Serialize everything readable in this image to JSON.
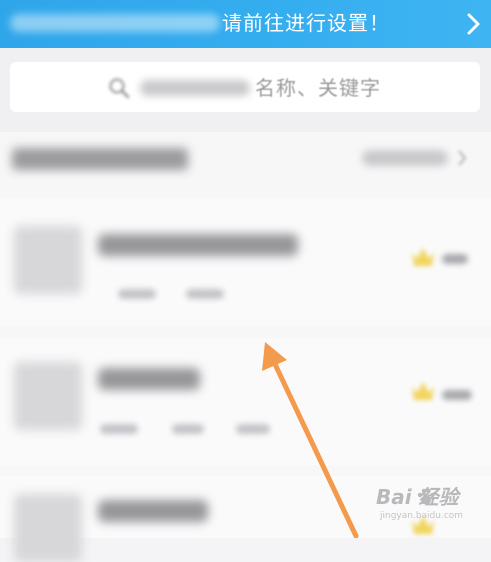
{
  "banner": {
    "text": "请前往进行设置！",
    "chevron_icon": "chevron-right-icon",
    "color": "#35aef0"
  },
  "search": {
    "visible_text": "名称、关键字",
    "icon": "search-icon"
  },
  "section": {
    "more_icon": "chevron-right-icon"
  },
  "list": {
    "items": [
      {
        "thumbnail": "blurred-image",
        "badge_icon": "crown-icon"
      },
      {
        "thumbnail": "blurred-image",
        "badge_icon": "crown-icon"
      },
      {
        "thumbnail": "blurred-image",
        "badge_icon": "crown-icon"
      }
    ],
    "badge_color": "#f2d45c"
  },
  "annotation": {
    "arrow_color": "#f39a4c"
  },
  "watermark": {
    "brand": "Bai  经验",
    "url": "jingyan.baidu.com",
    "paw_icon": "paw-icon"
  }
}
